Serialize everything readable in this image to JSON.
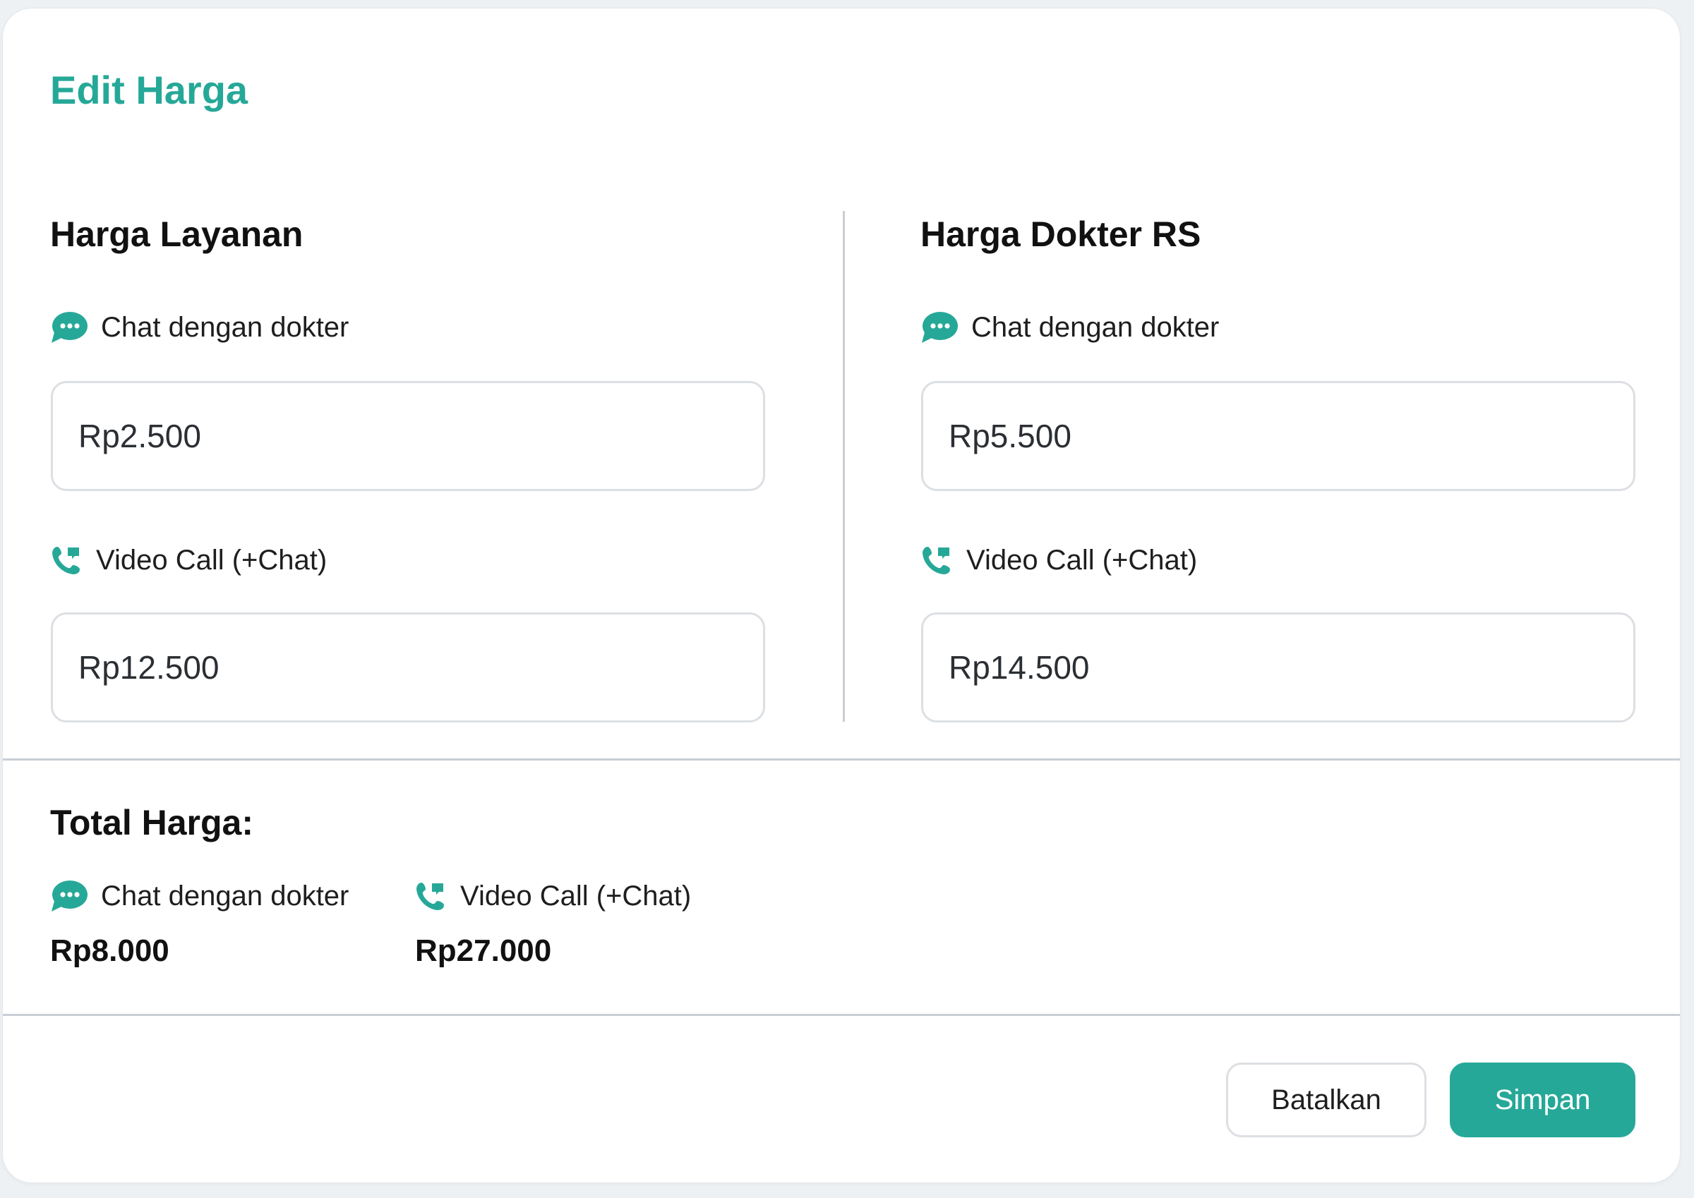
{
  "modal": {
    "title": "Edit Harga"
  },
  "colors": {
    "accent": "#26a898",
    "text": "#111111",
    "border": "#dcdfe3"
  },
  "service_price": {
    "title": "Harga Layanan",
    "chat": {
      "icon": "chat-bubble-icon",
      "label": "Chat dengan dokter",
      "value": "Rp2.500"
    },
    "video": {
      "icon": "phone-call-icon",
      "label": "Video Call (+Chat)",
      "value": "Rp12.500"
    }
  },
  "hospital_doctor_price": {
    "title": "Harga Dokter RS",
    "chat": {
      "icon": "chat-bubble-icon",
      "label": "Chat dengan dokter",
      "value": "Rp5.500"
    },
    "video": {
      "icon": "phone-call-icon",
      "label": "Video Call (+Chat)",
      "value": "Rp14.500"
    }
  },
  "total": {
    "title": "Total Harga:",
    "chat": {
      "icon": "chat-bubble-icon",
      "label": "Chat dengan dokter",
      "value": "Rp8.000"
    },
    "video": {
      "icon": "phone-call-icon",
      "label": "Video Call (+Chat)",
      "value": "Rp27.000"
    }
  },
  "footer": {
    "cancel_label": "Batalkan",
    "save_label": "Simpan"
  }
}
